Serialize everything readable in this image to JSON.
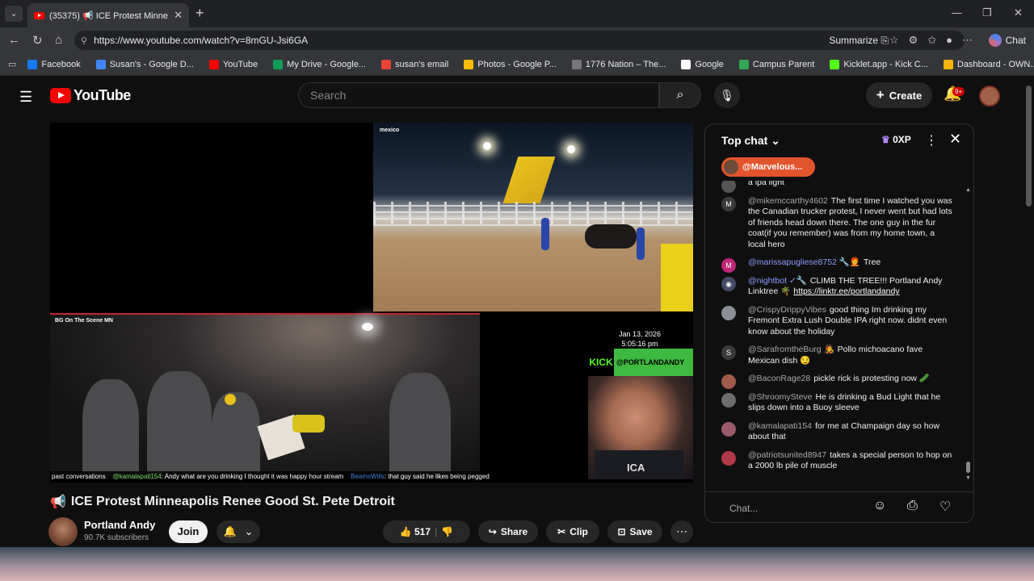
{
  "browser": {
    "tab_title": "(35375) 📢 ICE Protest Minne...",
    "url": "https://www.youtube.com/watch?v=8mGU-Jsi6GA",
    "summarize": "Summarize",
    "chat_label": "Chat",
    "bookmarks": [
      {
        "label": "Facebook",
        "color": "#1877f2"
      },
      {
        "label": "Susan's - Google D...",
        "color": "#4285f4"
      },
      {
        "label": "YouTube",
        "color": "#ff0000"
      },
      {
        "label": "My Drive - Google...",
        "color": "#0f9d58"
      },
      {
        "label": "susan's email",
        "color": "#ea4335"
      },
      {
        "label": "Photos - Google P...",
        "color": "#fbbc04"
      },
      {
        "label": "1776 Nation – The...",
        "color": "#777777"
      },
      {
        "label": "Google",
        "color": "#ffffff"
      },
      {
        "label": "Campus Parent",
        "color": "#34a853"
      },
      {
        "label": "Kicklet.app - Kick C...",
        "color": "#53fc18"
      },
      {
        "label": "Dashboard - OWN...",
        "color": "#f5b50a"
      }
    ]
  },
  "youtube": {
    "logo_text": "YouTube",
    "search_placeholder": "Search",
    "create_label": "Create",
    "notifications_badge": "9+"
  },
  "video": {
    "rodeo_tag": "mexico",
    "protest_tag": "BG On The Scene MN",
    "date": "Jan 13, 2026",
    "time": "5:05:16 pm",
    "kick_label": "KICK",
    "kick_handle": "@PORTLANDANDY",
    "shirt_text": "ICA",
    "ticker_prefix": "past conversations",
    "ticker_user1": "@kamalapati154",
    "ticker_msg1": ": Andy what are you drinking I thought it was happy hour stream",
    "ticker_user2": "BeamsWills",
    "ticker_msg2": ": that guy said he likes being pegged"
  },
  "title": {
    "emoji": "📢",
    "text": "ICE Protest Minneapolis Renee Good St. Pete Detroit"
  },
  "channel": {
    "name": "Portland Andy",
    "subscribers": "90.7K subscribers",
    "join_label": "Join"
  },
  "actions": {
    "likes": "517",
    "share": "Share",
    "clip": "Clip",
    "save": "Save"
  },
  "chat": {
    "header": "Top chat",
    "xp": "0XP",
    "pinned_user": "@Marvelous...",
    "input_placeholder": "Chat...",
    "messages": [
      {
        "user": "",
        "text": "a ipa light",
        "avatar": "",
        "avatar_color": "#555555"
      },
      {
        "user": "@mikemccarthy4602",
        "text": "The first time I watched you was the Canadian trucker protest, I never went but had lots of friends head down there. The one guy in the fur coat(if you remember) was from my home town, a local hero",
        "avatar": "M",
        "avatar_color": "#3a3a3a"
      },
      {
        "user": "@marissapugliese8752 🔧🧑‍🦰",
        "text": "Tree",
        "avatar": "M",
        "avatar_color": "#c0267a"
      },
      {
        "user": "@nightbot ✓🔧",
        "text": "CLIMB THE TREE!!! Portland Andy Linktree 🌴",
        "link": "https://linktr.ee/portlandandy",
        "avatar": "◉",
        "avatar_color": "#444a66"
      },
      {
        "user": "@CrispyDrippyVibes",
        "text": "good thing Im drinking my Fremont Extra Lush Double IPA right now. didnt even know about the holiday",
        "avatar": "",
        "avatar_color": "#8a8e96"
      },
      {
        "user": "@SarafromtheBurg 🧑‍🎤",
        "text": "Pollo michoacano fave Mexican dish 😏",
        "avatar": "S",
        "avatar_color": "#3a3a3a"
      },
      {
        "user": "@BaconRage28",
        "text": "pickle rick is protesting now 🥒",
        "avatar": "",
        "avatar_color": "#a05c4a"
      },
      {
        "user": "@ShroomySteve",
        "text": "He is drinking a Bud Light that he slips down into a Buoy sleeve",
        "avatar": "",
        "avatar_color": "#6d6d6d"
      },
      {
        "user": "@kamalapati154",
        "text": "for me at Champaign day so how about that",
        "avatar": "",
        "avatar_color": "#9a5a6a"
      },
      {
        "user": "@patriotsunited8947",
        "text": "takes a special person to hop on a 2000 lb pile of muscle",
        "avatar": "",
        "avatar_color": "#b23a48"
      }
    ]
  }
}
